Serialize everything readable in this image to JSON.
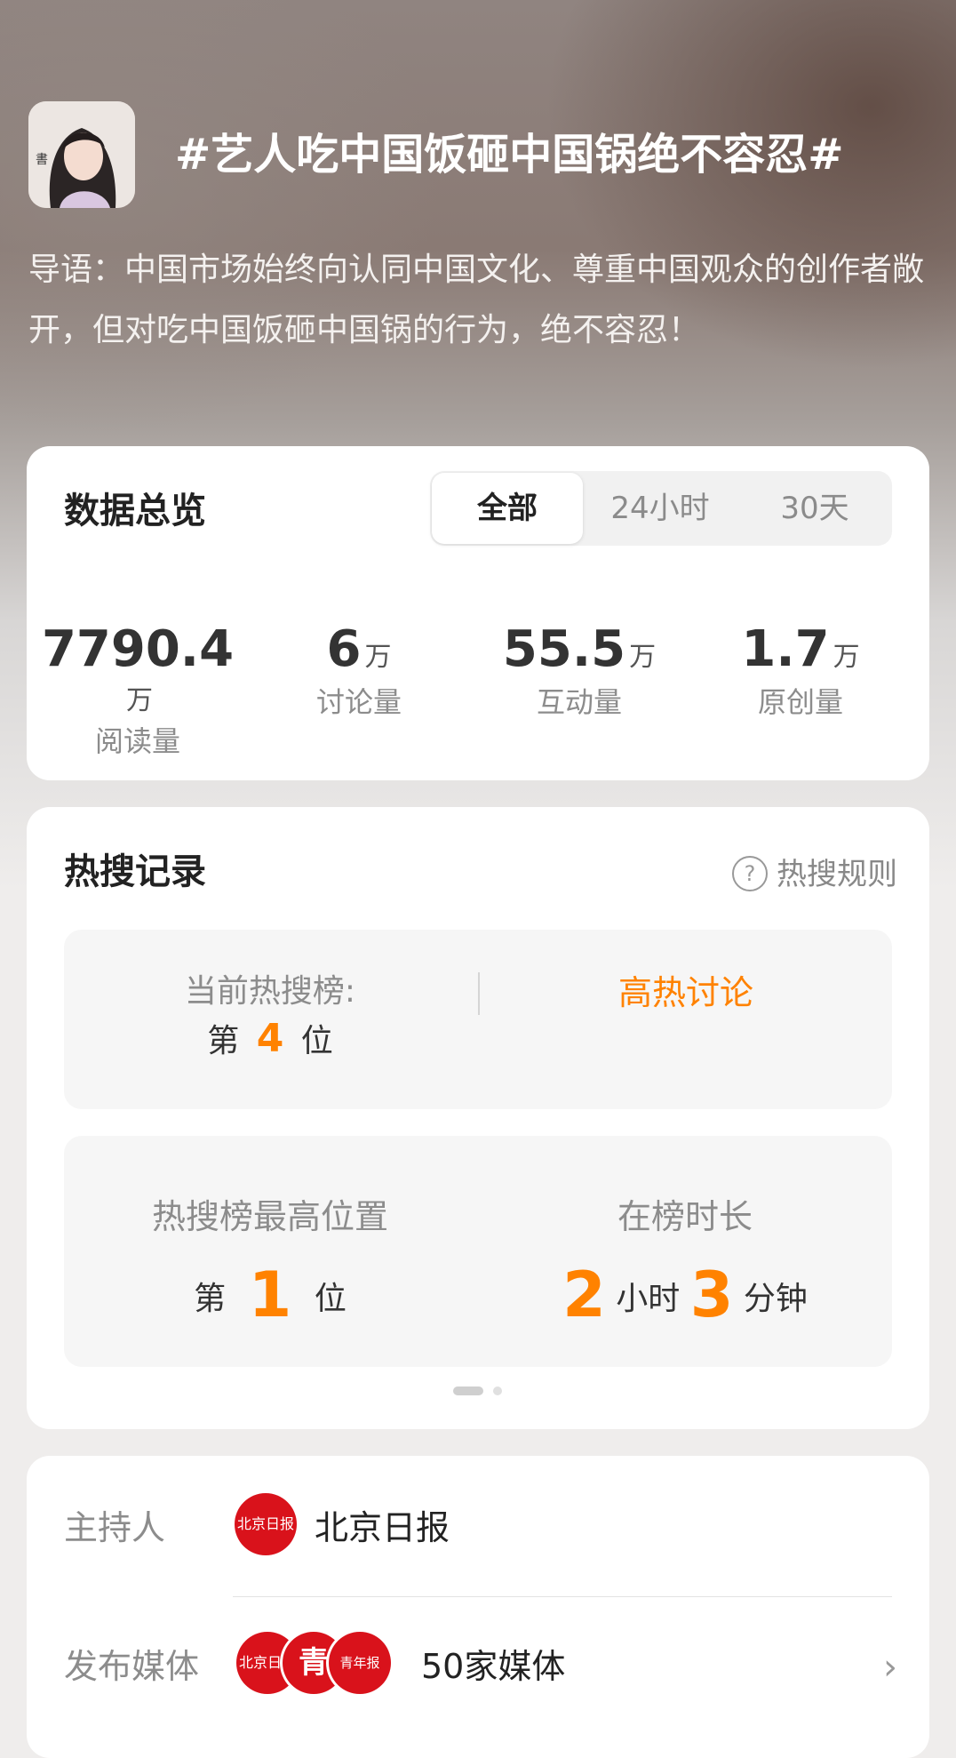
{
  "topic": {
    "title": "#艺人吃中国饭砸中国锅绝不容忍#",
    "intro": "导语：中国市场始终向认同中国文化、尊重中国观众的创作者敞开，但对吃中国饭砸中国锅的行为，绝不容忍！"
  },
  "overview": {
    "title": "数据总览",
    "tabs": [
      "全部",
      "24小时",
      "30天"
    ],
    "active_tab": "全部",
    "stats": [
      {
        "value": "7790.4",
        "unit": "万",
        "label": "阅读量"
      },
      {
        "value": "6",
        "unit": "万",
        "label": "讨论量"
      },
      {
        "value": "55.5",
        "unit": "万",
        "label": "互动量"
      },
      {
        "value": "1.7",
        "unit": "万",
        "label": "原创量"
      }
    ]
  },
  "hot_search": {
    "title": "热搜记录",
    "rules_label": "热搜规则",
    "current_label": "当前热搜榜:",
    "current_prefix": "第",
    "current_rank": "4",
    "current_suffix": "位",
    "status": "高热讨论",
    "best_label": "热搜榜最高位置",
    "best_prefix": "第",
    "best_rank": "1",
    "best_suffix": "位",
    "duration_label": "在榜时长",
    "duration_hours": "2",
    "hours_unit": "小时",
    "duration_minutes": "3",
    "minutes_unit": "分钟"
  },
  "host": {
    "label": "主持人",
    "name": "北京日报",
    "logo_text": "北京日报"
  },
  "media": {
    "label": "发布媒体",
    "count_text": "50家媒体",
    "logo_texts": [
      "北京日报",
      "青",
      "青年报"
    ]
  },
  "colors": {
    "accent": "#ff8200",
    "logo_red": "#d9121b"
  }
}
